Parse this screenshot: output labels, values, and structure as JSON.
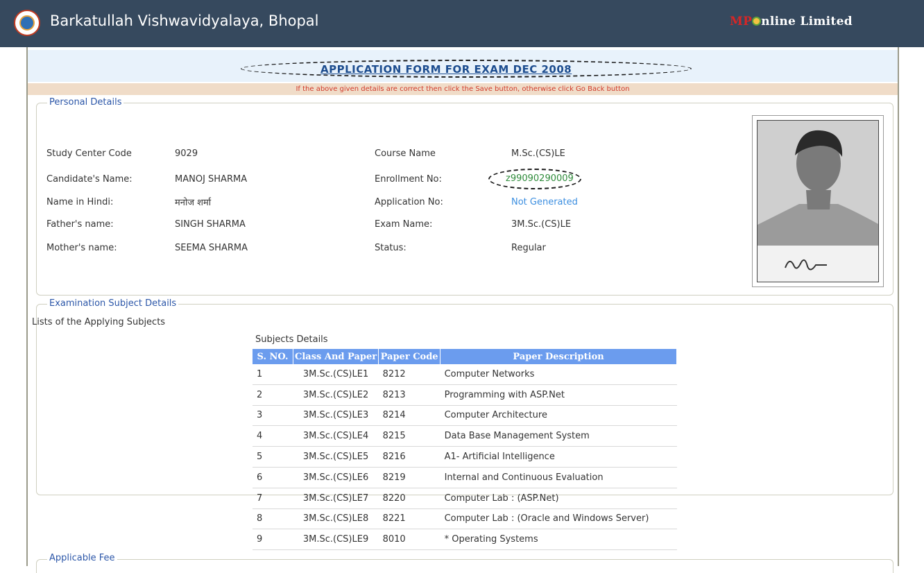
{
  "header": {
    "title": "Barkatullah Vishwavidyalaya, Bhopal",
    "brand_mp": "MP",
    "brand_rest": "nline Limited"
  },
  "form": {
    "heading": "APPLICATION FORM FOR EXAM DEC 2008",
    "notice": "If the above given details are correct then click the Save button, otherwise click Go Back button"
  },
  "personal": {
    "legend": "Personal Details",
    "study_center_label": "Study Center Code",
    "study_center_value": "9029",
    "candidate_label": "Candidate's Name:",
    "candidate_value": "MANOJ SHARMA",
    "hindi_label": "Name in Hindi:",
    "hindi_value": "मनोज शर्मा",
    "father_label": "Father's name:",
    "father_value": "SINGH SHARMA",
    "mother_label": "Mother's name:",
    "mother_value": "SEEMA SHARMA",
    "course_label": "Course Name",
    "course_value": "M.Sc.(CS)LE",
    "enroll_label": "Enrollment No:",
    "enroll_value": "z99090290009",
    "application_label": "Application No:",
    "application_value": "Not Generated",
    "exam_label": "Exam Name:",
    "exam_value": "3M.Sc.(CS)LE",
    "status_label": "Status:",
    "status_value": "Regular"
  },
  "exam_subjects": {
    "legend": "Examination Subject Details",
    "list_title": "Lists of the Applying Subjects",
    "table_caption": "Subjects Details",
    "columns": [
      "S. NO.",
      "Class And Paper",
      "Paper Code",
      "Paper Description"
    ],
    "rows": [
      [
        "1",
        "3M.Sc.(CS)LE1",
        "8212",
        "Computer Networks"
      ],
      [
        "2",
        "3M.Sc.(CS)LE2",
        "8213",
        "Programming with ASP.Net"
      ],
      [
        "3",
        "3M.Sc.(CS)LE3",
        "8214",
        "Computer Architecture"
      ],
      [
        "4",
        "3M.Sc.(CS)LE4",
        "8215",
        "Data Base Management System"
      ],
      [
        "5",
        "3M.Sc.(CS)LE5",
        "8216",
        "A1- Artificial Intelligence"
      ],
      [
        "6",
        "3M.Sc.(CS)LE6",
        "8219",
        "Internal and Continuous Evaluation"
      ],
      [
        "7",
        "3M.Sc.(CS)LE7",
        "8220",
        "Computer Lab : (ASP.Net)"
      ],
      [
        "8",
        "3M.Sc.(CS)LE8",
        "8221",
        "Computer Lab : (Oracle and Windows Server)"
      ],
      [
        "9",
        "3M.Sc.(CS)LE9",
        "8010",
        "* Operating Systems"
      ]
    ]
  },
  "fee": {
    "legend": "Applicable Fee"
  }
}
